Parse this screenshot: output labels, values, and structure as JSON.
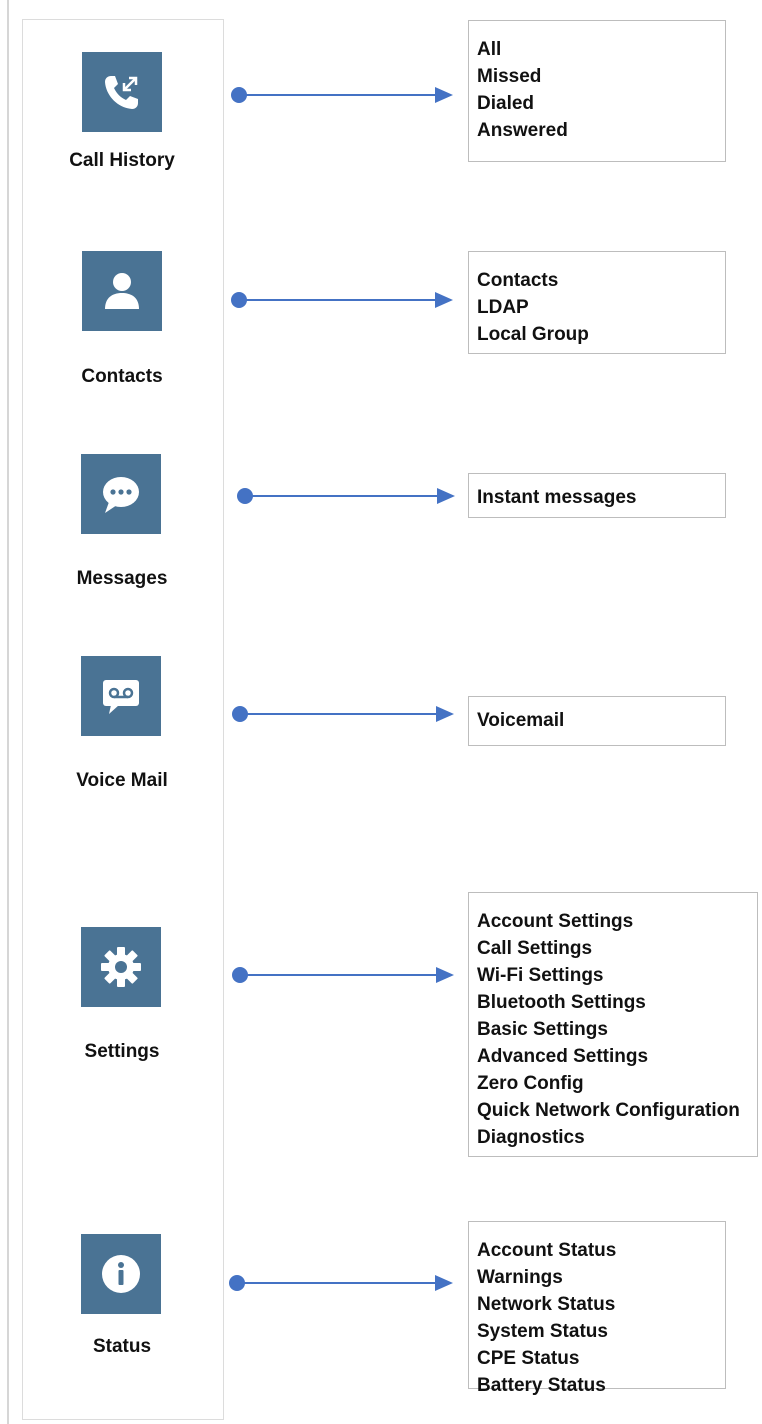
{
  "sections": [
    {
      "label": "Call History",
      "icon": "call-history-icon",
      "items": [
        "All",
        "Missed",
        "Dialed",
        "Answered"
      ]
    },
    {
      "label": "Contacts",
      "icon": "contacts-icon",
      "items": [
        "Contacts",
        "LDAP",
        "Local Group"
      ]
    },
    {
      "label": "Messages",
      "icon": "messages-icon",
      "items": [
        "Instant messages"
      ]
    },
    {
      "label": "Voice Mail",
      "icon": "voicemail-icon",
      "items": [
        "Voicemail"
      ]
    },
    {
      "label": "Settings",
      "icon": "settings-gear-icon",
      "items": [
        "Account Settings",
        "Call Settings",
        "Wi-Fi Settings",
        "Bluetooth Settings",
        "Basic Settings",
        "Advanced Settings",
        "Zero Config",
        "Quick Network Configuration",
        "Diagnostics"
      ]
    },
    {
      "label": "Status",
      "icon": "status-info-icon",
      "items": [
        "Account Status",
        "Warnings",
        "Network Status",
        "System Status",
        "CPE Status",
        "Battery Status"
      ]
    }
  ],
  "colors": {
    "icon_tile": "#4a7394",
    "connector": "#4472c4",
    "box_border": "#bdbdbd"
  }
}
